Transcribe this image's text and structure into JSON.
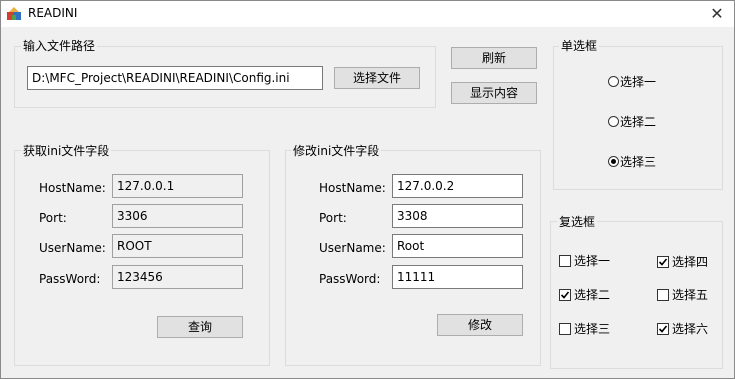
{
  "window": {
    "title": "READINI",
    "close_glyph": "✕",
    "icon": "app-icon"
  },
  "path_group": {
    "label": "输入文件路径",
    "path_value": "D:\\MFC_Project\\READINI\\READINI\\Config.ini",
    "choose_button": "选择文件"
  },
  "buttons": {
    "refresh": "刷新",
    "show_content": "显示内容",
    "query": "查询",
    "modify": "修改"
  },
  "read_group": {
    "label": "获取ini文件字段",
    "fields": [
      {
        "label": "HostName:",
        "value": "127.0.0.1"
      },
      {
        "label": "Port:",
        "value": "3306"
      },
      {
        "label": "UserName:",
        "value": "ROOT"
      },
      {
        "label": "PassWord:",
        "value": "123456"
      }
    ]
  },
  "edit_group": {
    "label": "修改ini文件字段",
    "fields": [
      {
        "label": "HostName:",
        "value": "127.0.0.2"
      },
      {
        "label": "Port:",
        "value": "3308"
      },
      {
        "label": "UserName:",
        "value": "Root"
      },
      {
        "label": "PassWord:",
        "value": "11111"
      }
    ]
  },
  "radio_group": {
    "label": "单选框",
    "options": [
      {
        "label": "选择一",
        "selected": false
      },
      {
        "label": "选择二",
        "selected": false
      },
      {
        "label": "选择三",
        "selected": true
      }
    ]
  },
  "check_group": {
    "label": "复选框",
    "options": [
      {
        "label": "选择一",
        "checked": false
      },
      {
        "label": "选择四",
        "checked": true
      },
      {
        "label": "选择二",
        "checked": true
      },
      {
        "label": "选择五",
        "checked": false
      },
      {
        "label": "选择三",
        "checked": false
      },
      {
        "label": "选择六",
        "checked": true
      }
    ]
  }
}
